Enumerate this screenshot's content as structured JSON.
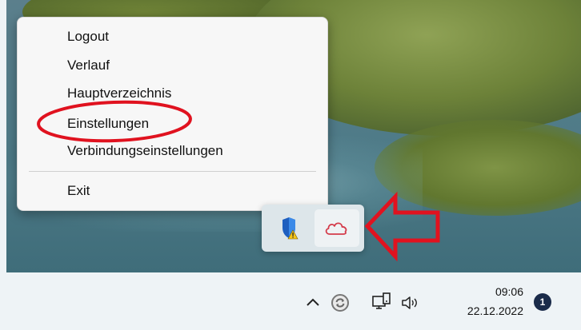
{
  "context_menu": {
    "items": [
      {
        "label": "Logout"
      },
      {
        "label": "Verlauf"
      },
      {
        "label": "Hauptverzeichnis"
      },
      {
        "label": "Einstellungen",
        "highlighted": true
      },
      {
        "label": "Verbindungseinstellungen"
      },
      {
        "label": "Exit"
      }
    ]
  },
  "tray_popup": {
    "icons": [
      "shield-warning-icon",
      "cloud-icon"
    ]
  },
  "taskbar": {
    "icons": [
      "chevron-up-icon",
      "sync-app-icon",
      "network-icon",
      "volume-icon"
    ],
    "time": "09:06",
    "date": "22.12.2022",
    "notification_count": "1"
  },
  "annotations": {
    "ellipse_color": "#e0121f",
    "arrow_color": "#e0121f"
  }
}
